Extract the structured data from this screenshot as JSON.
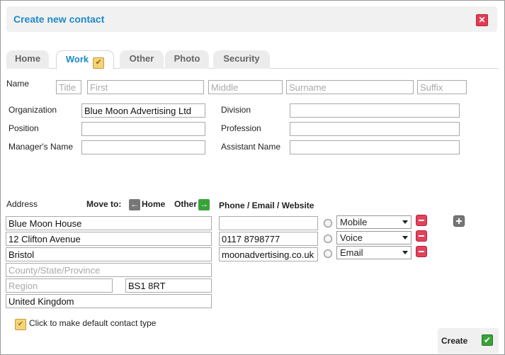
{
  "dialog": {
    "title": "Create new contact",
    "close_icon": "close-icon"
  },
  "tabs": [
    {
      "label": "Home"
    },
    {
      "label": "Work",
      "active": true
    },
    {
      "label": "Other"
    },
    {
      "label": "Photo"
    },
    {
      "label": "Security"
    }
  ],
  "name": {
    "label": "Name",
    "title_placeholder": "Title",
    "first_placeholder": "First",
    "middle_placeholder": "Middle",
    "surname_placeholder": "Surname",
    "suffix_placeholder": "Suffix"
  },
  "work": {
    "organization_label": "Organization",
    "organization_value": "Blue Moon Advertising Ltd",
    "division_label": "Division",
    "position_label": "Position",
    "profession_label": "Profession",
    "manager_label": "Manager's Name",
    "assistant_label": "Assistant Name"
  },
  "address": {
    "label": "Address",
    "move_to_label": "Move to:",
    "move_home_label": "Home",
    "move_other_label": "Other",
    "line1": "Blue Moon House",
    "line2": "12 Clifton Avenue",
    "city": "Bristol",
    "county_placeholder": "County/State/Province",
    "region_placeholder": "Region",
    "postcode": "BS1 8RT",
    "country": "United Kingdom"
  },
  "contact_methods": {
    "heading": "Phone / Email / Website",
    "rows": [
      {
        "value": "",
        "type": "Mobile"
      },
      {
        "value": "0117 8798777",
        "type": "Voice"
      },
      {
        "value": "moonadvertising.co.uk",
        "type": "Email"
      }
    ]
  },
  "default_type_label": "Click to make default contact type",
  "footer": {
    "create_label": "Create"
  },
  "colors": {
    "accent": "#1d8ac7",
    "remove": "#e2425b",
    "confirm": "#3aa23a"
  }
}
